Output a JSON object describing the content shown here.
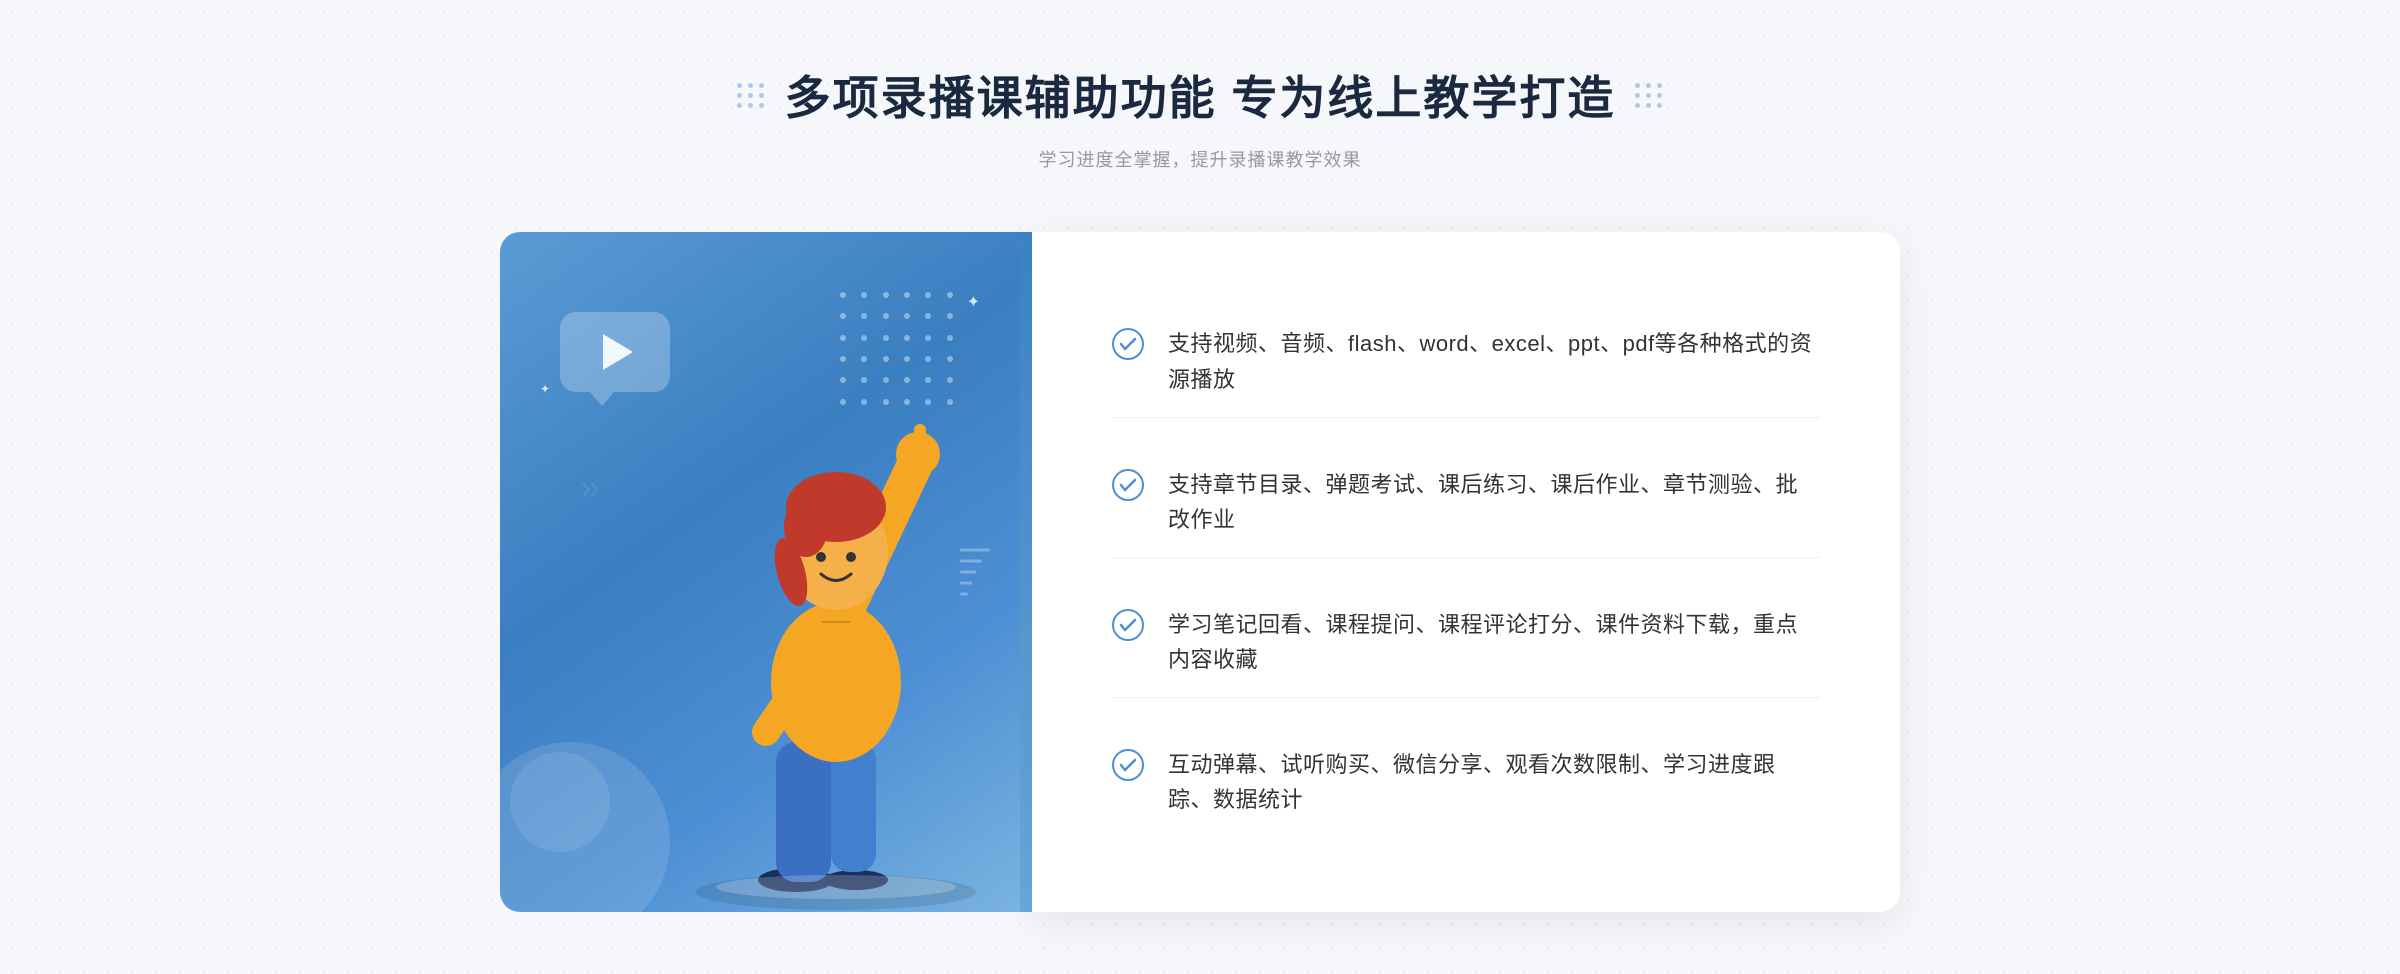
{
  "header": {
    "main_title": "多项录播课辅助功能 专为线上教学打造",
    "subtitle": "学习进度全掌握，提升录播课教学效果",
    "decoration_left": "decorative-dots",
    "decoration_right": "decorative-dots"
  },
  "features": [
    {
      "id": 1,
      "text": "支持视频、音频、flash、word、excel、ppt、pdf等各种格式的资源播放"
    },
    {
      "id": 2,
      "text": "支持章节目录、弹题考试、课后练习、课后作业、章节测验、批改作业"
    },
    {
      "id": 3,
      "text": "学习笔记回看、课程提问、课程评论打分、课件资料下载，重点内容收藏"
    },
    {
      "id": 4,
      "text": "互动弹幕、试听购买、微信分享、观看次数限制、学习进度跟踪、数据统计"
    }
  ],
  "illustration": {
    "play_button_label": "play",
    "figure_label": "teaching figure"
  },
  "colors": {
    "primary_blue": "#4d8fd4",
    "light_blue": "#7ab3e0",
    "dark_blue": "#3a7fc1",
    "text_dark": "#1a2940",
    "text_gray": "#999999",
    "text_body": "#333333",
    "check_color": "#4d8fd4",
    "bg": "#f5f7fa"
  }
}
